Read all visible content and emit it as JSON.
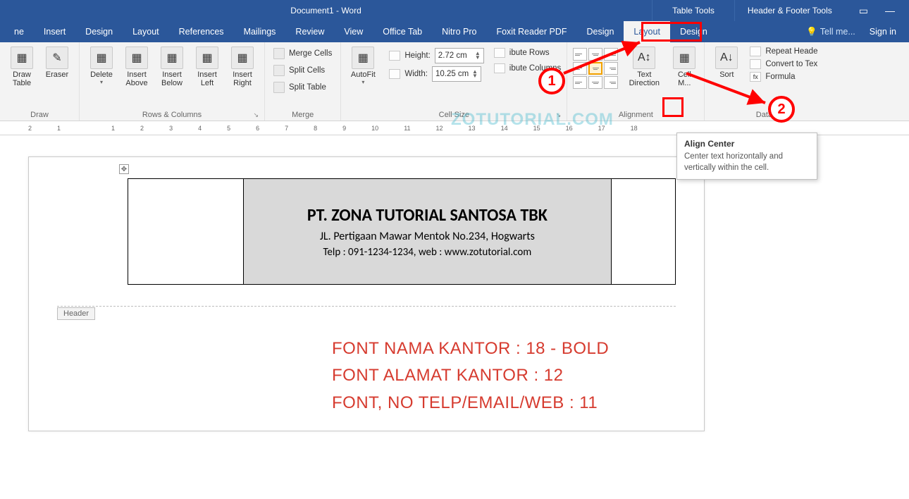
{
  "titlebar": {
    "title": "Document1 - Word",
    "tool_tabs": {
      "table": "Table Tools",
      "hf": "Header & Footer Tools"
    }
  },
  "tabs": {
    "items": [
      "ne",
      "Insert",
      "Design",
      "Layout",
      "References",
      "Mailings",
      "Review",
      "View",
      "Office Tab",
      "Nitro Pro",
      "Foxit Reader PDF"
    ],
    "context": {
      "design": "Design",
      "layout": "Layout",
      "hf_design": "Design"
    },
    "tellme": "Tell me...",
    "signin": "Sign in"
  },
  "ribbon": {
    "draw": {
      "label": "Draw",
      "draw_table": "Draw\nTable",
      "eraser": "Eraser"
    },
    "rows": {
      "label": "Rows & Columns",
      "delete": "Delete",
      "above": "Insert\nAbove",
      "below": "Insert\nBelow",
      "left": "Insert\nLeft",
      "right": "Insert\nRight"
    },
    "merge": {
      "label": "Merge",
      "merge": "Merge Cells",
      "split": "Split Cells",
      "split_table": "Split Table"
    },
    "cellsize": {
      "label": "Cell Size",
      "autofit": "AutoFit",
      "height_lbl": "Height:",
      "height": "2.72 cm",
      "width_lbl": "Width:",
      "width": "10.25 cm",
      "dist_rows": "ibute Rows",
      "dist_cols": "ibute Columns"
    },
    "alignment": {
      "label": "Alignment",
      "text_dir": "Text\nDirection",
      "cell_m": "Cell\nM..."
    },
    "data": {
      "label": "Data",
      "sort": "Sort",
      "repeat": "Repeat Heade",
      "convert": "Convert to Tex",
      "formula": "Formula"
    }
  },
  "tooltip": {
    "title": "Align Center",
    "body": "Center text horizontally and vertically within the cell."
  },
  "annotations": {
    "one": "1",
    "two": "2"
  },
  "watermark": "ZOTUTORIAL.COM",
  "ruler": [
    "2",
    "1",
    "",
    "1",
    "2",
    "3",
    "4",
    "5",
    "6",
    "7",
    "8",
    "9",
    "10",
    "11",
    "12",
    "13",
    "14",
    "15",
    "16",
    "17",
    "18"
  ],
  "doc": {
    "company": "PT. ZONA TUTORIAL SANTOSA TBK",
    "address": "JL. Pertigaan Mawar Mentok No.234, Hogwarts",
    "contact": "Telp : 091-1234-1234, web : www.zotutorial.com",
    "header_tag": "Header"
  },
  "notes": {
    "l1": "Font Nama Kantor : 18 - Bold",
    "l2": "Font ALAMAT Kantor : 12",
    "l3": "Font, No telp/email/web : 11"
  }
}
